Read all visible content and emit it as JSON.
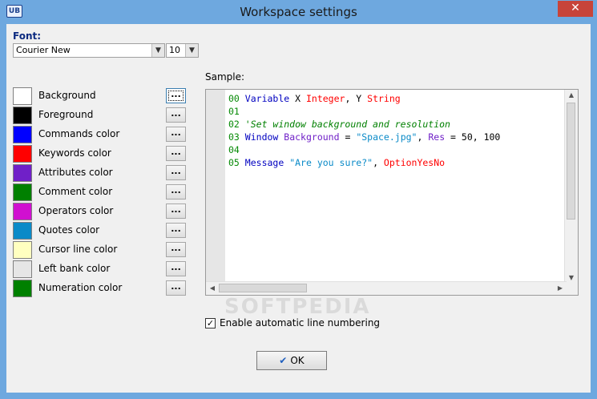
{
  "window": {
    "title": "Workspace settings",
    "app_icon_text": "UB",
    "close_glyph": "✕"
  },
  "font": {
    "label": "Font:",
    "family": "Courier New",
    "size": "10"
  },
  "colors": {
    "browse_label": "...",
    "items": [
      {
        "label": "Background",
        "color": "#ffffff"
      },
      {
        "label": "Foreground",
        "color": "#000000"
      },
      {
        "label": "Commands color",
        "color": "#0000ff"
      },
      {
        "label": "Keywords color",
        "color": "#ff0000"
      },
      {
        "label": "Attributes color",
        "color": "#7020c8"
      },
      {
        "label": "Comment color",
        "color": "#008000"
      },
      {
        "label": "Operators color",
        "color": "#d010d0"
      },
      {
        "label": "Quotes color",
        "color": "#0a8ac8"
      },
      {
        "label": "Cursor line color",
        "color": "#ffffc0"
      },
      {
        "label": "Left bank color",
        "color": "#e6e6e6"
      },
      {
        "label": "Numeration color",
        "color": "#008000"
      }
    ]
  },
  "sample": {
    "label": "Sample:",
    "lines": [
      {
        "num": "00",
        "tokens": [
          {
            "t": "Variable",
            "c": "#0000c0"
          },
          {
            "t": " X ",
            "c": "#000000"
          },
          {
            "t": "Integer",
            "c": "#ff0000"
          },
          {
            "t": ", Y ",
            "c": "#000000"
          },
          {
            "t": "String",
            "c": "#ff0000"
          }
        ]
      },
      {
        "num": "01",
        "tokens": []
      },
      {
        "num": "02",
        "tokens": [
          {
            "t": "'Set window background and resolution",
            "c": "#008000",
            "i": true
          }
        ]
      },
      {
        "num": "03",
        "tokens": [
          {
            "t": "Window",
            "c": "#0000c0"
          },
          {
            "t": " ",
            "c": "#000000"
          },
          {
            "t": "Background",
            "c": "#7020c8"
          },
          {
            "t": " = ",
            "c": "#000000"
          },
          {
            "t": "\"Space.jpg\"",
            "c": "#0a8ac8"
          },
          {
            "t": ", ",
            "c": "#000000"
          },
          {
            "t": "Res",
            "c": "#7020c8"
          },
          {
            "t": " = 50, 100",
            "c": "#000000"
          }
        ]
      },
      {
        "num": "04",
        "tokens": []
      },
      {
        "num": "05",
        "tokens": [
          {
            "t": "Message",
            "c": "#0000c0"
          },
          {
            "t": " ",
            "c": "#000000"
          },
          {
            "t": "\"Are you sure?\"",
            "c": "#0a8ac8"
          },
          {
            "t": ", ",
            "c": "#000000"
          },
          {
            "t": "OptionYesNo",
            "c": "#ff0000"
          }
        ]
      }
    ]
  },
  "options": {
    "auto_numbering_label": "Enable automatic line numbering",
    "auto_numbering_checked": true
  },
  "watermark": "SOFTPEDIA",
  "ok_button": {
    "label": "OK",
    "icon": "✔"
  }
}
